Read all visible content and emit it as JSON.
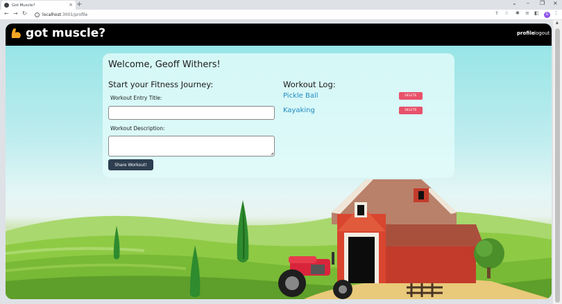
{
  "browser": {
    "tab_title": "Got Muscle?",
    "tab_close": "×",
    "new_tab": "+",
    "window_minimize": "–",
    "window_maximize": "❐",
    "window_close": "×",
    "url_host": "localhost",
    "url_path": ":3001/profile",
    "profile_initial": "G"
  },
  "app": {
    "logo_text": "got muscle?",
    "nav": {
      "profile": "profile",
      "logout": "logout"
    }
  },
  "profile": {
    "welcome": "Welcome, Geoff Withers!",
    "form_heading": "Start your Fitness Journey:",
    "title_label": "Workout Entry Title:",
    "title_value": "",
    "description_label": "Workout Description:",
    "description_value": "",
    "share_button": "Share Workout!",
    "log_heading": "Workout Log:",
    "workouts": [
      {
        "title": "Pickle Ball",
        "delete_label": "DELETE"
      },
      {
        "title": "Kayaking",
        "delete_label": "DELETE"
      }
    ]
  },
  "colors": {
    "accent_blue": "#1f8bc3",
    "delete_red": "#e8526a",
    "button_dark": "#2d3e50",
    "logo_orange": "#f5a623"
  }
}
